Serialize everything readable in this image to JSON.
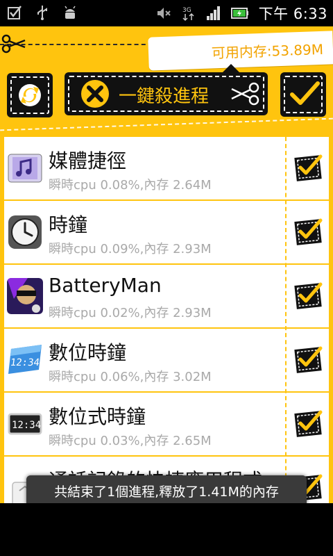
{
  "status_bar": {
    "icons_left": [
      "notification-check-icon",
      "usb-icon",
      "android-icon"
    ],
    "icons_right": [
      "mute-icon",
      "3g-data-icon",
      "signal-bars-icon",
      "battery-charging-icon"
    ],
    "time": "下午 6:33"
  },
  "header": {
    "memory_label": "可用内存:53.89M",
    "kill_button_label": "一鍵殺進程"
  },
  "processes": [
    {
      "name": "媒體捷徑",
      "stats": "瞬時cpu 0.08%,內存 2.64M",
      "icon": "media-shortcut-icon",
      "checked": true
    },
    {
      "name": "時鐘",
      "stats": "瞬時cpu 0.09%,內存 2.93M",
      "icon": "clock-icon",
      "checked": true
    },
    {
      "name": "BatteryMan",
      "stats": "瞬時cpu 0.02%,內存 2.93M",
      "icon": "batteryman-icon",
      "checked": true
    },
    {
      "name": "數位時鐘",
      "stats": "瞬時cpu 0.06%,內存 3.02M",
      "icon": "digital-clock-icon",
      "checked": true
    },
    {
      "name": "數位式時鐘",
      "stats": "瞬時cpu 0.03%,內存 2.65M",
      "icon": "digital-clock-widget-icon",
      "checked": true
    },
    {
      "name": "通話記錄的快捷應用程式",
      "stats": "",
      "icon": "call-log-icon",
      "checked": true
    }
  ],
  "toast": {
    "message": "共結束了1個進程,釋放了1.41M的內存"
  },
  "colors": {
    "accent_yellow": "#ffc40e",
    "dark": "#111111",
    "memory_text": "#f2a300"
  }
}
